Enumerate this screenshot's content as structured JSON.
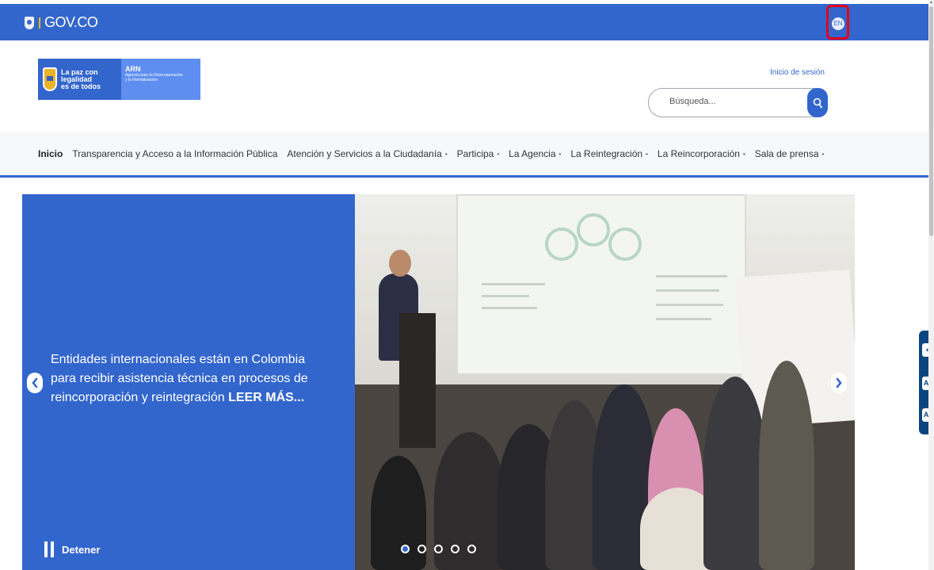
{
  "gov_bar": {
    "logo_text": "GOV.CO",
    "lang_button": "EN"
  },
  "header": {
    "logo": {
      "left_text": [
        "La paz con",
        "legalidad",
        "es de todos"
      ],
      "title": "ARN",
      "subtitle": [
        "Agencia para la Reincorporación",
        "y la Normalización"
      ]
    },
    "login_link": "Inicio de sesión",
    "search": {
      "placeholder": "Búsqueda...",
      "icon": "search-icon"
    }
  },
  "nav": {
    "items": [
      {
        "label": "Inicio",
        "active": true,
        "dropdown": false
      },
      {
        "label": "Transparencia y Acceso a la Información Pública",
        "active": false,
        "dropdown": false
      },
      {
        "label": "Atención y Servicios a la Ciudadanía",
        "active": false,
        "dropdown": true
      },
      {
        "label": "Participa",
        "active": false,
        "dropdown": true
      },
      {
        "label": "La Agencia",
        "active": false,
        "dropdown": true
      },
      {
        "label": "La Reintegración",
        "active": false,
        "dropdown": true
      },
      {
        "label": "La Reincorporación",
        "active": false,
        "dropdown": true
      },
      {
        "label": "Sala de prensa",
        "active": false,
        "dropdown": true
      }
    ]
  },
  "hero": {
    "text": "Entidades internacionales están en Colombia para recibir asistencia técnica en procesos de reincorporación y reintegración",
    "cta": "LEER MÁS...",
    "pause_label": "Detener",
    "slides": 5,
    "active_slide": 1
  },
  "accessibility": {
    "buttons": [
      {
        "icon": "contrast-icon",
        "label": "◐"
      },
      {
        "icon": "increase-font-icon",
        "label": "A⁺"
      },
      {
        "icon": "decrease-font-icon",
        "label": "A⁻"
      }
    ]
  },
  "colors": {
    "primary": "#3366cc",
    "lang_highlight": "#e3001b",
    "access_bar": "#0b457f"
  }
}
